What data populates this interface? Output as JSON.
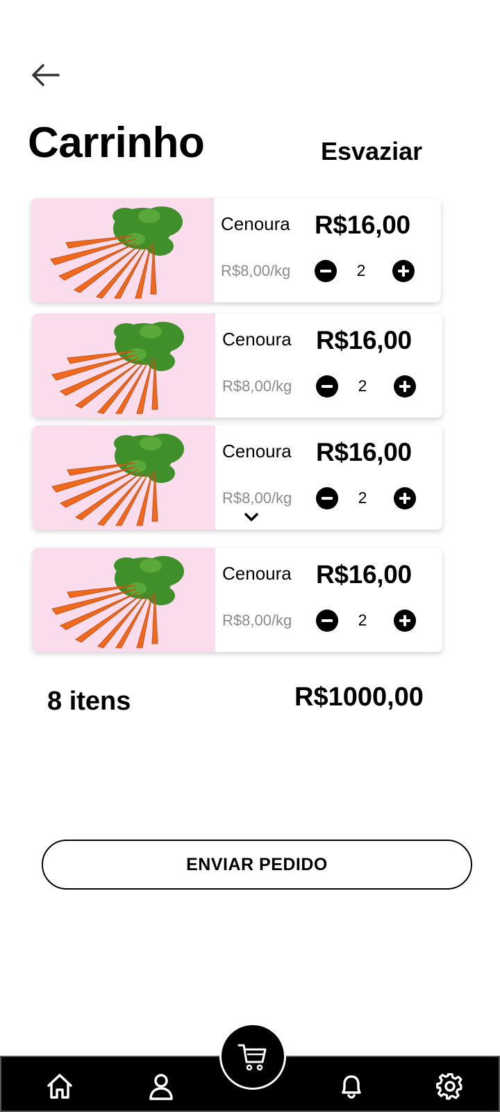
{
  "header": {
    "back_icon": "arrow-left-icon",
    "title": "Carrinho",
    "clear_label": "Esvaziar"
  },
  "cart": {
    "items": [
      {
        "name": "Cenoura",
        "unit_price": "R$8,00/kg",
        "total": "R$16,00",
        "quantity": "2",
        "image": "carrot-bunch"
      },
      {
        "name": "Cenoura",
        "unit_price": "R$8,00/kg",
        "total": "R$16,00",
        "quantity": "2",
        "image": "carrot-bunch"
      },
      {
        "name": "Cenoura",
        "unit_price": "R$8,00/kg",
        "total": "R$16,00",
        "quantity": "2",
        "image": "carrot-bunch"
      },
      {
        "name": "Cenoura",
        "unit_price": "R$8,00/kg",
        "total": "R$16,00",
        "quantity": "2",
        "image": "carrot-bunch"
      }
    ]
  },
  "summary": {
    "count": "8 itens",
    "total": "R$1000,00"
  },
  "submit_label": "ENVIAR PEDIDO",
  "nav": {
    "items": [
      "home-icon",
      "user-icon",
      "cart-icon",
      "bell-icon",
      "gear-icon"
    ],
    "active": "cart-icon"
  },
  "colors": {
    "image_background": "#fadcec",
    "secondary_text": "#8a8a8a",
    "nav_background": "#000000"
  }
}
